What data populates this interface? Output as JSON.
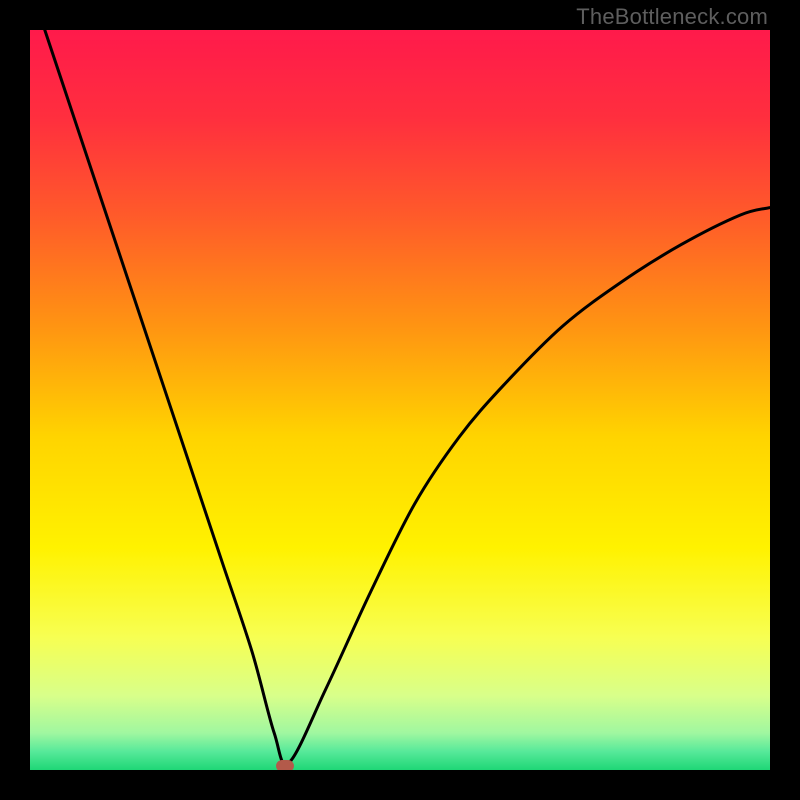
{
  "watermark": "TheBottleneck.com",
  "chart_data": {
    "type": "line",
    "title": "",
    "xlabel": "",
    "ylabel": "",
    "xlim": [
      0,
      100
    ],
    "ylim": [
      0,
      100
    ],
    "series": [
      {
        "name": "bottleneck-curve",
        "x": [
          2,
          6,
          10,
          14,
          18,
          22,
          26,
          30,
          33,
          35,
          40,
          46,
          52,
          58,
          64,
          72,
          80,
          88,
          96,
          100
        ],
        "y": [
          100,
          88,
          76,
          64,
          52,
          40,
          28,
          16,
          5,
          1,
          11,
          24,
          36,
          45,
          52,
          60,
          66,
          71,
          75,
          76
        ]
      }
    ],
    "gradient_stops": [
      {
        "offset": 0.0,
        "color": "#ff1a4b"
      },
      {
        "offset": 0.12,
        "color": "#ff2f3e"
      },
      {
        "offset": 0.25,
        "color": "#ff5a2a"
      },
      {
        "offset": 0.4,
        "color": "#ff9412"
      },
      {
        "offset": 0.55,
        "color": "#ffd400"
      },
      {
        "offset": 0.7,
        "color": "#fff200"
      },
      {
        "offset": 0.82,
        "color": "#f7ff52"
      },
      {
        "offset": 0.9,
        "color": "#d8ff8a"
      },
      {
        "offset": 0.95,
        "color": "#a0f7a0"
      },
      {
        "offset": 0.975,
        "color": "#57e99a"
      },
      {
        "offset": 1.0,
        "color": "#1ed776"
      }
    ],
    "minimum_marker": {
      "x": 34.5,
      "y": 0.5,
      "color": "#b35a4a"
    }
  }
}
